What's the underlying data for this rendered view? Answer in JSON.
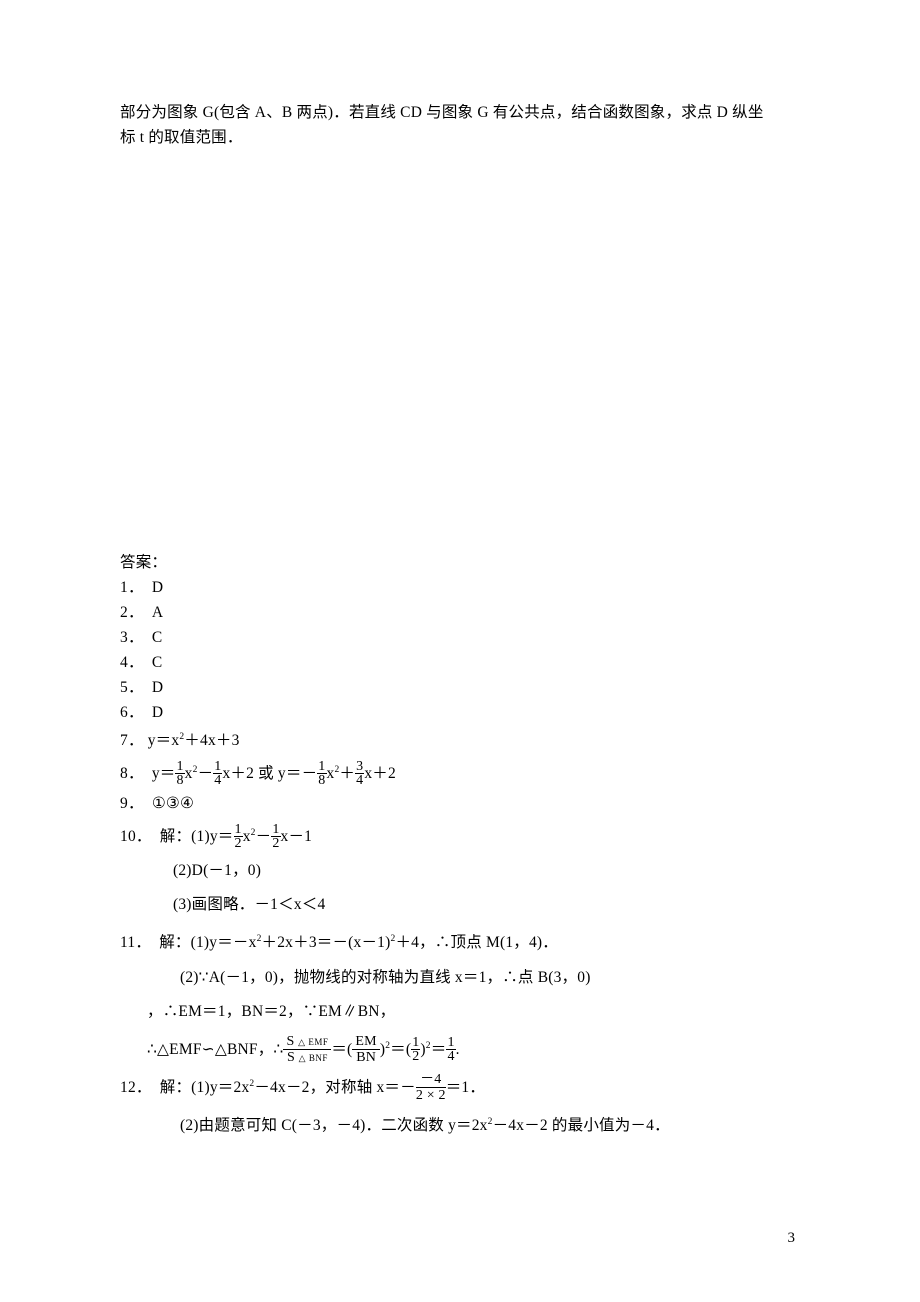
{
  "intro": {
    "l1": "部分为图象 G(包含 A、B 两点)．若直线 CD 与图象 G 有公共点，结合函数图象，求点 D 纵坐",
    "l2": "标 t 的取值范围．"
  },
  "header": "答案：",
  "a1": {
    "n": "1．",
    "v": "D"
  },
  "a2": {
    "n": "2．",
    "v": "A"
  },
  "a3": {
    "n": "3．",
    "v": "C"
  },
  "a4": {
    "n": "4．",
    "v": "C"
  },
  "a5": {
    "n": "5．",
    "v": "D"
  },
  "a6": {
    "n": "6．",
    "v": "D"
  },
  "a7": {
    "n": "7．",
    "pre": "y＝x",
    "mid": "＋4x＋3"
  },
  "a8": {
    "n": "8．",
    "pre": "y＝",
    "f1t": "1",
    "f1b": "8",
    "m1": "x",
    "sq1": "2",
    "m2": "－",
    "f2t": "1",
    "f2b": "4",
    "m3": "x＋2 或 y＝－",
    "f3t": "1",
    "f3b": "8",
    "m4": "x",
    "sq2": "2",
    "m5": "＋",
    "f4t": "3",
    "f4b": "4",
    "m6": "x＋2"
  },
  "a9": {
    "n": "9．",
    "v": "①③④"
  },
  "a10": {
    "n": "10．",
    "lead": "解：(1)y＝",
    "f1t": "1",
    "f1b": "2",
    "m1": "x",
    "sq1": "2",
    "m2": "－",
    "f2t": "1",
    "f2b": "2",
    "m3": "x－1",
    "l2": "(2)D(－1，0)",
    "l3": "(3)画图略．－1＜x＜4"
  },
  "a11": {
    "n": "11．",
    "l1a": "解：(1)y＝－x",
    "l1b": "＋2x＋3＝－(x－1)",
    "l1c": "＋4，∴顶点 M(1，4)．",
    "l2": "(2)∵A(－1，0)，抛物线的对称轴为直线 x＝1，∴点 B(3，0)",
    "l3": "，∴EM＝1，BN＝2，∵EM∥BN，",
    "l4a": "∴△EMF∽△BNF，∴",
    "f1t_pre": "S ",
    "f1t_tri": "△ ",
    "f1t_lbl": "EMF",
    "f1b_pre": "S ",
    "f1b_tri": "△ ",
    "f1b_lbl": "BNF",
    "l4b": "＝(",
    "f2t": "EM",
    "f2b": "BN",
    "l4c": ")",
    "sq": "2",
    "l4d": "＝(",
    "f3t": "1",
    "f3b": "2",
    "l4e": ")",
    "sq2": "2",
    "l4f": "＝",
    "f4t": "1",
    "f4b": "4",
    "l4g": "."
  },
  "a12": {
    "n": "12．",
    "l1a": "解：(1)y＝2x",
    "l1b": "－4x－2，对称轴 x＝－",
    "ft": "－4",
    "fb": "2 × 2",
    "l1c": "＝1．",
    "l2a": "(2)由题意可知 C(－3，－4)．二次函数 y＝2x",
    "l2b": "－4x－2 的最小值为－4．"
  },
  "page": "3"
}
